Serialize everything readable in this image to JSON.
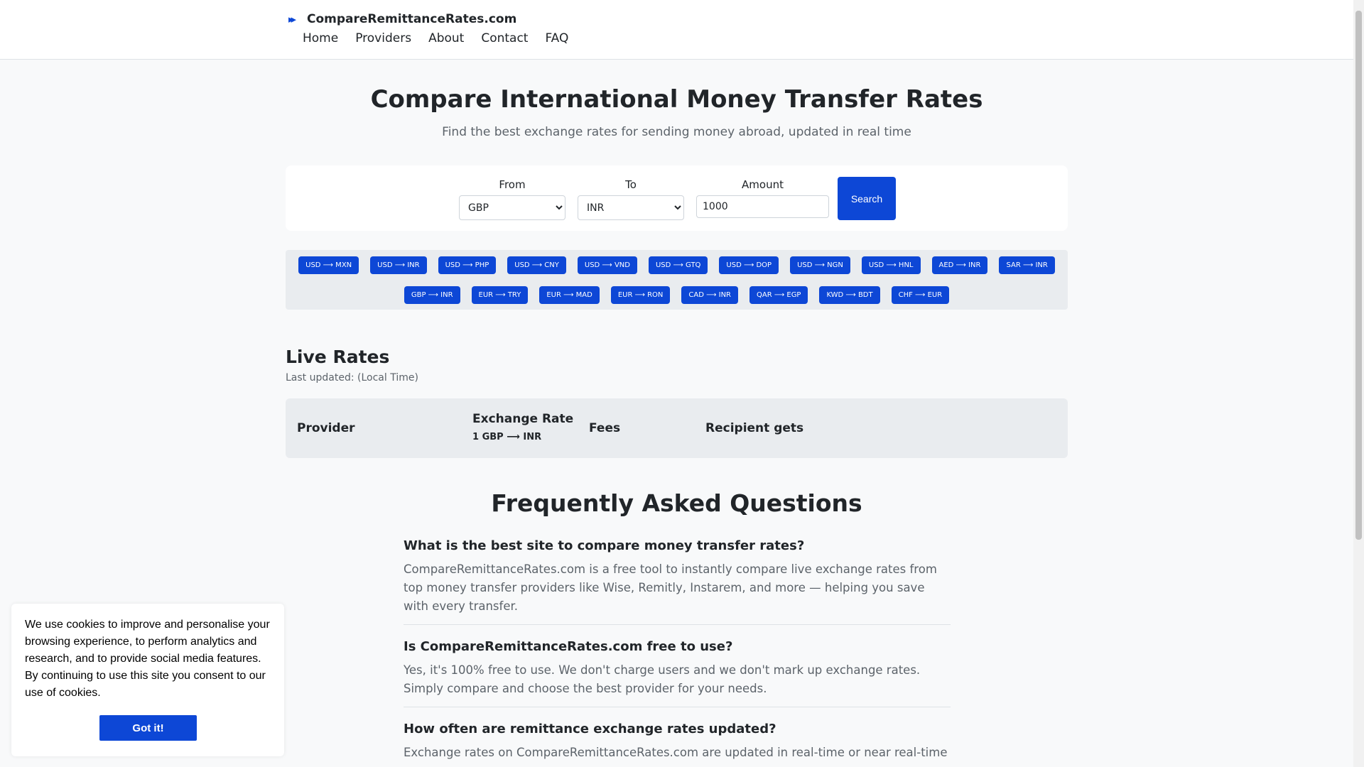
{
  "header": {
    "brand": "CompareRemittanceRates.com",
    "nav": [
      "Home",
      "Providers",
      "About",
      "Contact",
      "FAQ"
    ]
  },
  "hero": {
    "title": "Compare International Money Transfer Rates",
    "subtitle": "Find the best exchange rates for sending money abroad, updated in real time"
  },
  "search": {
    "from_label": "From",
    "from_value": "GBP",
    "to_label": "To",
    "to_value": "INR",
    "amount_label": "Amount",
    "amount_value": "1000",
    "button": "Search"
  },
  "pairs_row1": [
    "USD ⟶ MXN",
    "USD ⟶ INR",
    "USD ⟶ PHP",
    "USD ⟶ CNY",
    "USD ⟶ VND",
    "USD ⟶ GTQ",
    "USD ⟶ DOP",
    "USD ⟶ NGN",
    "USD ⟶ HNL",
    "AED ⟶ INR",
    "SAR ⟶ INR"
  ],
  "pairs_row2": [
    "GBP ⟶ INR",
    "EUR ⟶ TRY",
    "EUR ⟶ MAD",
    "EUR ⟶ RON",
    "CAD ⟶ INR",
    "QAR ⟶ EGP",
    "KWD ⟶ BDT",
    "CHF ⟶ EUR"
  ],
  "live": {
    "title": "Live Rates",
    "updated": "Last updated: (Local Time)",
    "col_provider": "Provider",
    "col_rate": "Exchange Rate",
    "col_rate_sub": "1 GBP ⟶ INR",
    "col_fees": "Fees",
    "col_recipient": "Recipient gets"
  },
  "faq": {
    "title": "Frequently Asked Questions",
    "items": [
      {
        "q": "What is the best site to compare money transfer rates?",
        "a": "CompareRemittanceRates.com is a free tool to instantly compare live exchange rates from top money transfer providers like Wise, Remitly, Instarem, and more — helping you save with every transfer."
      },
      {
        "q": "Is CompareRemittanceRates.com free to use?",
        "a": "Yes, it's 100% free to use. We don't charge users and we don't mark up exchange rates. Simply compare and choose the best provider for your needs."
      },
      {
        "q": "How often are remittance exchange rates updated?",
        "a": "Exchange rates on CompareRemittanceRates.com are updated in real-time or near real-time"
      }
    ]
  },
  "cookie": {
    "text": "We use cookies to improve and personalise your browsing experience, to perform analytics and research, and to provide social media features. By continuing to use this site you consent to our use of cookies.",
    "button": "Got it!"
  },
  "colors": {
    "accent": "#0d47d6",
    "muted": "#5c636a",
    "panel": "#e9ecef"
  },
  "icons": {
    "brand": "double-chevron-right-icon"
  }
}
